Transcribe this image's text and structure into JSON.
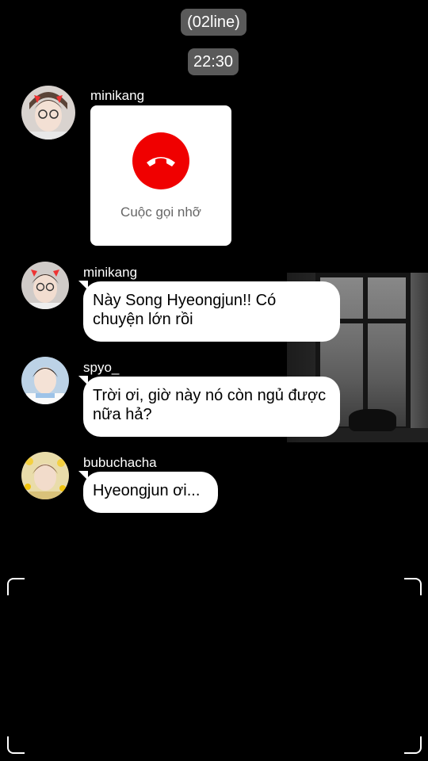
{
  "header": {
    "title": "(02line)",
    "time": "22:30"
  },
  "colors": {
    "background": "#000000",
    "pill": "#5a5a5a",
    "bubble": "#ffffff",
    "missed_call": "#f00000"
  },
  "messages": [
    {
      "sender": "minikang",
      "type": "missed_call",
      "label": "Cuộc gọi nhỡ",
      "icon": "phone-hangup-icon"
    },
    {
      "sender": "minikang",
      "type": "text",
      "text": "Này Song Hyeongjun!! Có chuyện lớn rồi"
    },
    {
      "sender": "spyo_",
      "type": "text",
      "text": "Trời ơi, giờ này nó còn ngủ được nữa hả?"
    },
    {
      "sender": "bubuchacha",
      "type": "text",
      "text": "Hyeongjun ơi..."
    }
  ]
}
